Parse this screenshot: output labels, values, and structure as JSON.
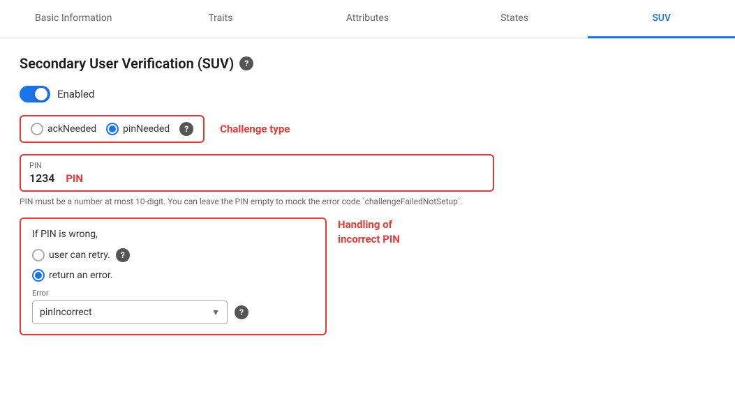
{
  "tabs": [
    {
      "id": "basic-information",
      "label": "Basic Information",
      "active": false
    },
    {
      "id": "traits",
      "label": "Traits",
      "active": false
    },
    {
      "id": "attributes",
      "label": "Attributes",
      "active": false
    },
    {
      "id": "states",
      "label": "States",
      "active": false
    },
    {
      "id": "suv",
      "label": "SUV",
      "active": true
    }
  ],
  "page": {
    "title": "Secondary User Verification (SUV)",
    "toggle_label": "Enabled",
    "challenge_type_annotation": "Challenge type",
    "radio_ack": "ackNeeded",
    "radio_pin": "pinNeeded",
    "pin_label": "PIN",
    "pin_value": "1234",
    "pin_annotation": "PIN",
    "pin_hint": "PIN must be a number at most 10-digit. You can leave the PIN empty to mock the error code `challengeFailedNotSetup`.",
    "incorrect_pin_title": "If PIN is wrong,",
    "radio_retry": "user can retry.",
    "radio_error": "return an error.",
    "error_label": "Error",
    "error_value": "pinIncorrect",
    "handling_annotation_line1": "Handling of",
    "handling_annotation_line2": "incorrect PIN"
  }
}
